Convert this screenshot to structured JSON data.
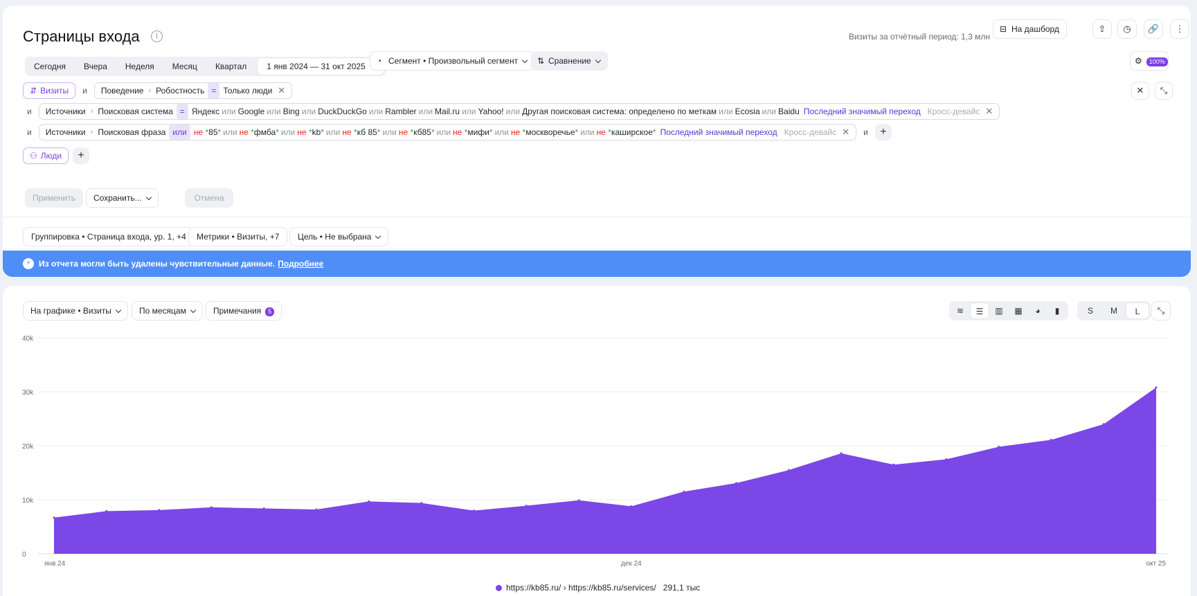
{
  "header": {
    "title": "Страницы входа",
    "visits_period": "Визиты за отчётный период: 1,3 млн",
    "dashboard_label": "На дашборд"
  },
  "dates": {
    "presets": [
      "Сегодня",
      "Вчера",
      "Неделя",
      "Месяц",
      "Квартал"
    ],
    "range": "1 янв 2024 — 31 окт 2025"
  },
  "segment_label": "Сегмент • Произвольный сегмент",
  "compare_label": "Сравнение",
  "sampling_badge": "100%",
  "filters": {
    "visits_chip": "Визиты",
    "and": "и",
    "or": "или",
    "not": "не",
    "eq": "=",
    "behavior": {
      "cat": "Поведение",
      "field": "Робостность",
      "value": "Только люди"
    },
    "search_system": {
      "cat": "Источники",
      "field": "Поисковая система",
      "values": [
        "Яндекс",
        "Google",
        "Bing",
        "DuckDuckGo",
        "Rambler",
        "Mail.ru",
        "Yahoo!",
        "Другая поисковая система: определено по меткам",
        "Ecosia",
        "Baidu"
      ],
      "attribution": "Последний значимый переход",
      "cross": "Кросс-девайс"
    },
    "search_phrase": {
      "cat": "Источники",
      "field": "Поисковая фраза",
      "values": [
        "85",
        "фмба",
        "kb",
        "кб 85",
        "кб85",
        "мифи",
        "москворечье",
        "каширское"
      ],
      "attribution": "Последний значимый переход",
      "cross": "Кросс-девайс"
    },
    "people_chip": "Люди"
  },
  "actions": {
    "apply": "Применить",
    "save": "Сохранить...",
    "cancel": "Отмена"
  },
  "report": {
    "grouping": "Группировка • Страница входа, ур. 1, +4",
    "metrics": "Метрики • Визиты, +7",
    "goal": "Цель • Не выбрана"
  },
  "banner": {
    "text": "Из отчета могли быть удалены чувствительные данные.",
    "link": "Подробнее"
  },
  "chart_controls": {
    "metric": "На графике • Визиты",
    "period": "По месяцам",
    "notes": "Примечания",
    "notes_count": "5",
    "sizes": [
      "S",
      "M",
      "L"
    ],
    "active_size": "L"
  },
  "chart_data": {
    "type": "area",
    "color": "#7b47e6",
    "ylim": [
      0,
      40000
    ],
    "y_ticks": [
      "0",
      "10k",
      "20k",
      "30k",
      "40k"
    ],
    "x_tick_labels": [
      {
        "index": 0,
        "label": "янв 24"
      },
      {
        "index": 11,
        "label": "дек 24"
      },
      {
        "index": 21,
        "label": "окт 25"
      }
    ],
    "categories": [
      "янв 24",
      "фев 24",
      "мар 24",
      "апр 24",
      "май 24",
      "июн 24",
      "июл 24",
      "авг 24",
      "сен 24",
      "окт 24",
      "ноя 24",
      "дек 24",
      "янв 25",
      "фев 25",
      "мар 25",
      "апр 25",
      "май 25",
      "июн 25",
      "июл 25",
      "авг 25",
      "сен 25",
      "окт 25"
    ],
    "series": [
      {
        "name": "https://kb85.ru/ › https://kb85.ru/services/",
        "values": [
          6700,
          7900,
          8100,
          8600,
          8400,
          8200,
          9700,
          9400,
          8000,
          8900,
          9900,
          8800,
          11500,
          13100,
          15500,
          18600,
          16500,
          17500,
          19800,
          21100,
          24000,
          30800
        ]
      }
    ],
    "legend_value": "291,1 тыс"
  }
}
